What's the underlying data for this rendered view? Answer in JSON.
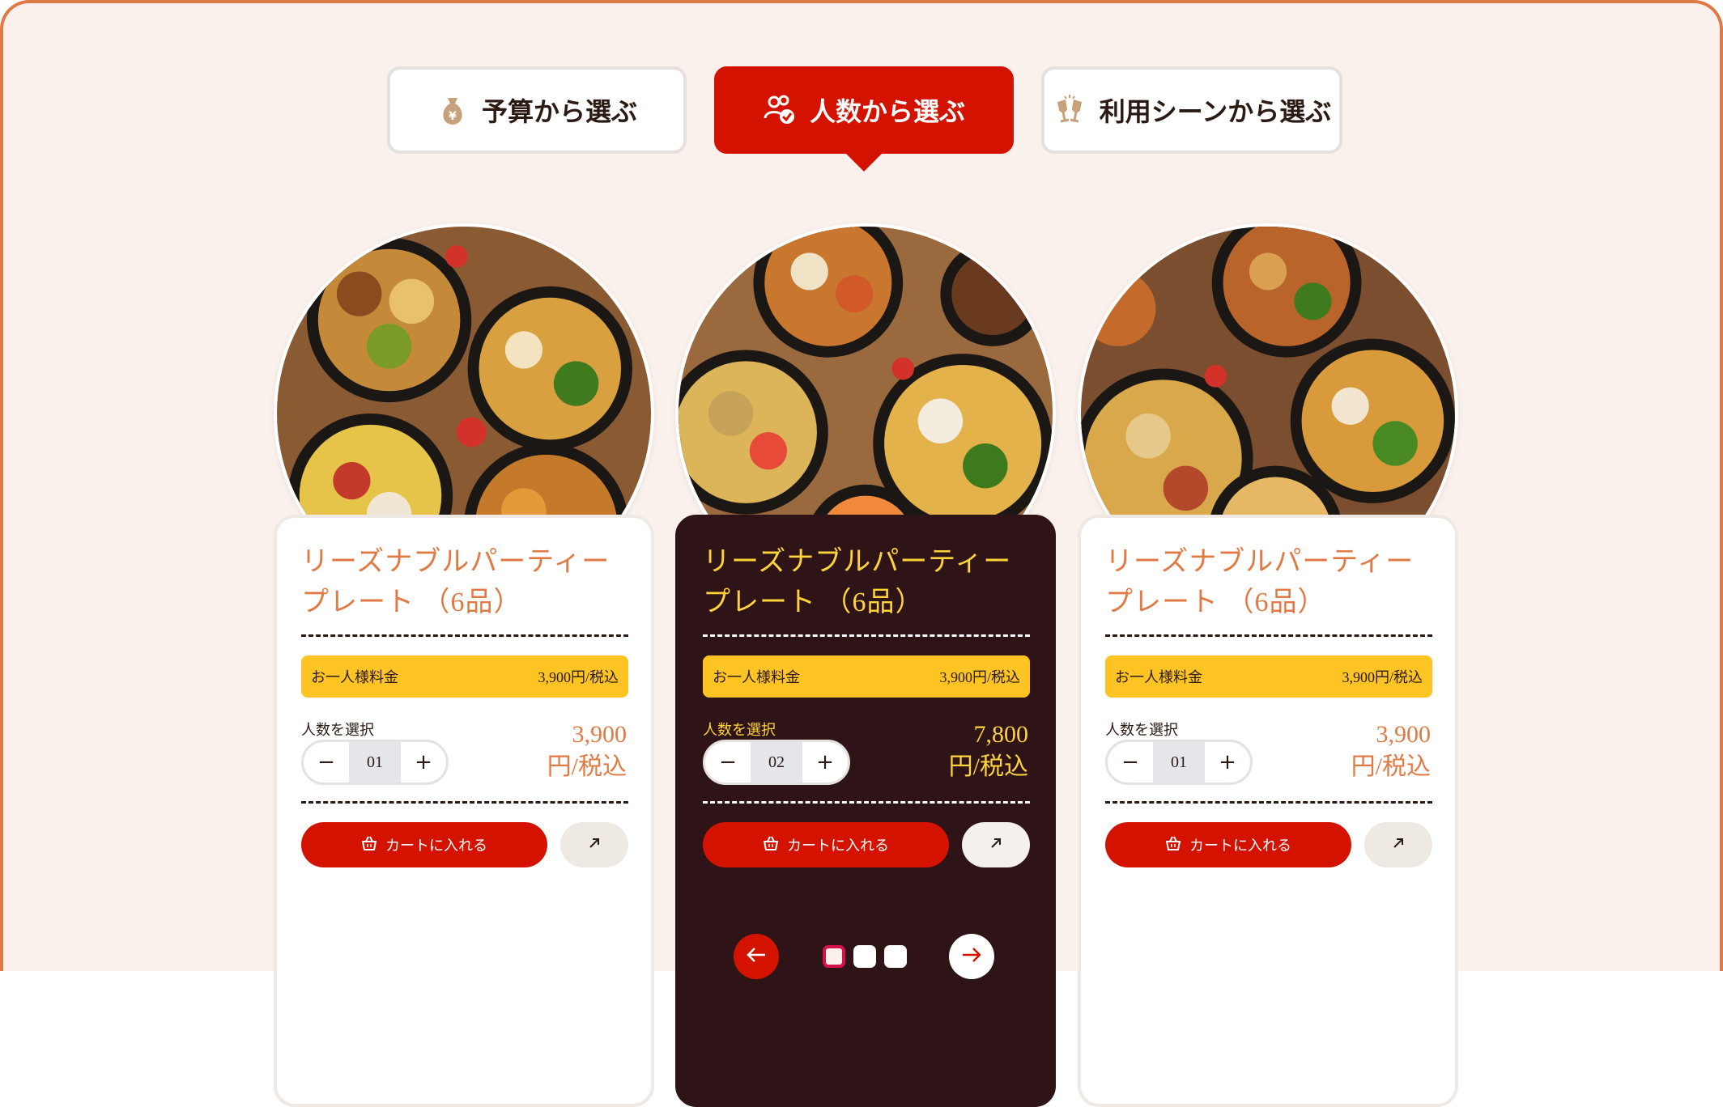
{
  "tabs": [
    {
      "label": "予算から選ぶ",
      "icon": "money-bag-icon",
      "active": false
    },
    {
      "label": "人数から選ぶ",
      "icon": "people-check-icon",
      "active": true
    },
    {
      "label": "利用シーンから選ぶ",
      "icon": "toast-glasses-icon",
      "active": false
    }
  ],
  "cards": [
    {
      "title": "リーズナブルパーティープレート （6品）",
      "price_label": "お一人様料金",
      "price_value": "3,900円/税込",
      "people_label": "人数を選択",
      "quantity": "01",
      "minus": "−",
      "plus": "+",
      "total_amount": "3,900",
      "total_unit": "円/税込",
      "cart_label": "カートに入れる",
      "highlighted": false
    },
    {
      "title": "リーズナブルパーティープレート （6品）",
      "price_label": "お一人様料金",
      "price_value": "3,900円/税込",
      "people_label": "人数を選択",
      "quantity": "02",
      "minus": "−",
      "plus": "+",
      "total_amount": "7,800",
      "total_unit": "円/税込",
      "cart_label": "カートに入れる",
      "highlighted": true
    },
    {
      "title": "リーズナブルパーティープレート （6品）",
      "price_label": "お一人様料金",
      "price_value": "3,900円/税込",
      "people_label": "人数を選択",
      "quantity": "01",
      "minus": "−",
      "plus": "+",
      "total_amount": "3,900",
      "total_unit": "円/税込",
      "cart_label": "カートに入れる",
      "highlighted": false
    }
  ],
  "pagination": {
    "current_page": 1,
    "page_count": 3,
    "prev_icon": "arrow-left-icon",
    "next_icon": "arrow-right-icon"
  },
  "colors": {
    "accent_red": "#d31300",
    "brand_orange": "#e07a44",
    "price_yellow": "#fdc423",
    "dark_panel": "#2e1416",
    "page_background": "#faf1ec"
  }
}
